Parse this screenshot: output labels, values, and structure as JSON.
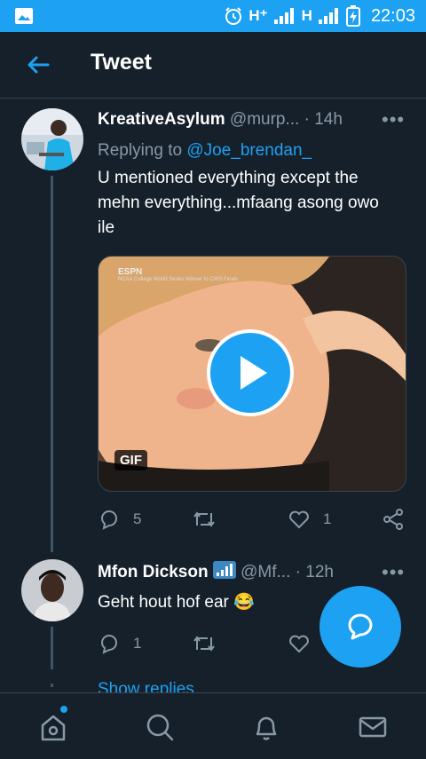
{
  "status_bar": {
    "network1": "H⁺",
    "network2": "H",
    "time": "22:03"
  },
  "header": {
    "title": "Tweet"
  },
  "tweets": [
    {
      "name": "KreativeAsylum",
      "handle": "@murp...",
      "time": "· 14h",
      "replying_label": "Replying to",
      "replying_to": "@Joe_brendan_",
      "text": "U mentioned everything except the mehn everything...mfaang asong owo ile",
      "media": {
        "badge": "GIF",
        "watermark": "ESPN",
        "caption": "NCAA College World Series Winner to CWS Finals"
      },
      "replies": "5",
      "retweets": "",
      "likes": "1"
    },
    {
      "name": "Mfon Dickson",
      "handle": "@Mf...",
      "time": "· 12h",
      "text": "Geht hout hof ear 😂",
      "replies": "1",
      "retweets": "",
      "likes": ""
    }
  ],
  "show_replies": "Show replies",
  "colors": {
    "accent": "#1da1f2",
    "background": "#15202b",
    "muted": "#8899a6"
  }
}
